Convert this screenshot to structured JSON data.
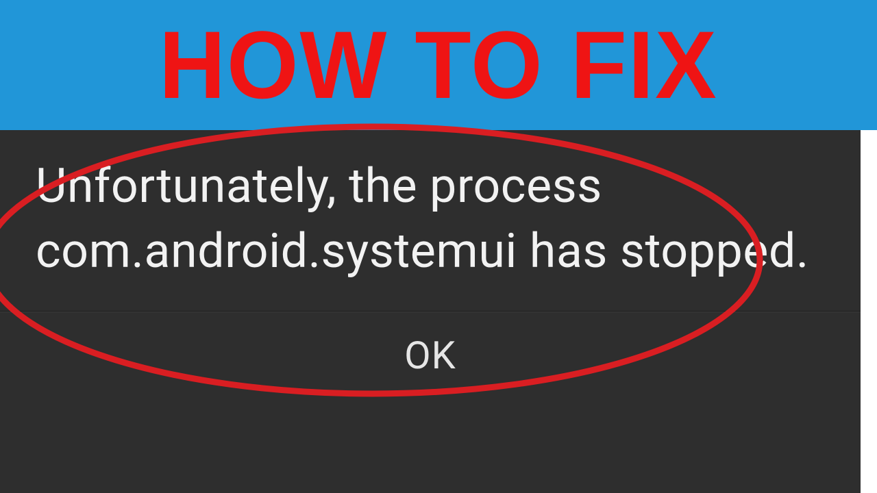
{
  "banner": {
    "title": "HOW TO FIX"
  },
  "dialog": {
    "message": "Unfortunately, the process com.android.systemui has stopped.",
    "ok_label": "OK"
  },
  "colors": {
    "banner_bg": "#2196d8",
    "title_red": "#ef1414",
    "dialog_bg": "#2e2e2e",
    "ellipse_stroke": "#d91e22"
  }
}
